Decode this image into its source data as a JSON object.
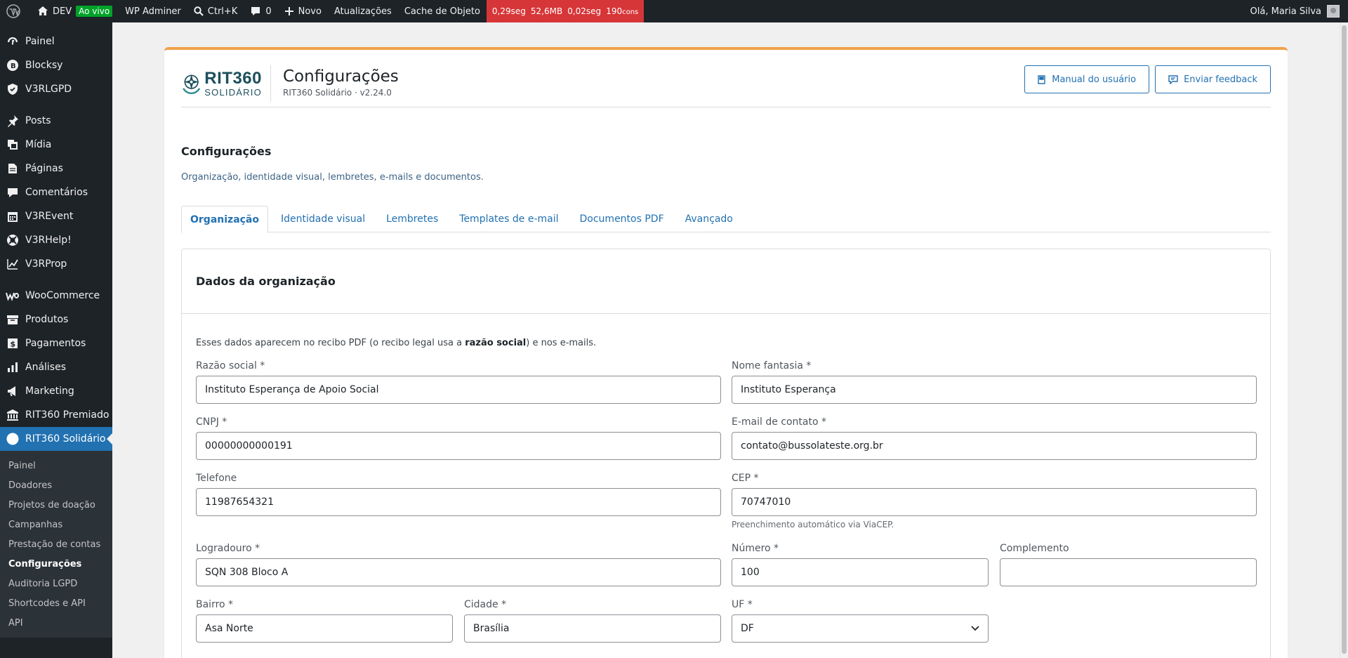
{
  "adminbar": {
    "site_name": "DEV",
    "live_badge": "Ao vivo",
    "adminer": "WP Adminer",
    "search_shortcut": "Ctrl+K",
    "comments_count": "0",
    "new_label": "Novo",
    "updates_label": "Atualizações",
    "cache_label": "Cache de Objeto",
    "perf": {
      "time": "0,29seg",
      "memory": "52,6MB",
      "query_time": "0,02seg",
      "queries": "190",
      "queries_unit": "cons"
    },
    "greeting": "Olá, Maria Silva"
  },
  "sidebar": {
    "items": [
      {
        "label": "Painel",
        "icon": "dashboard-icon"
      },
      {
        "label": "Blocksy",
        "icon": "blocksy-icon"
      },
      {
        "label": "V3RLGPD",
        "icon": "shield-icon"
      },
      {
        "label": "Posts",
        "icon": "pin-icon"
      },
      {
        "label": "Mídia",
        "icon": "media-icon"
      },
      {
        "label": "Páginas",
        "icon": "page-icon"
      },
      {
        "label": "Comentários",
        "icon": "comment-icon"
      },
      {
        "label": "V3REvent",
        "icon": "calendar-icon"
      },
      {
        "label": "V3RHelp!",
        "icon": "lifebuoy-icon"
      },
      {
        "label": "V3RProp",
        "icon": "chart-line-icon"
      },
      {
        "label": "WooCommerce",
        "icon": "woo-icon"
      },
      {
        "label": "Produtos",
        "icon": "archive-icon"
      },
      {
        "label": "Pagamentos",
        "icon": "payments-icon"
      },
      {
        "label": "Análises",
        "icon": "bar-chart-icon"
      },
      {
        "label": "Marketing",
        "icon": "megaphone-icon"
      },
      {
        "label": "RIT360 Premiado",
        "icon": "bank-icon"
      },
      {
        "label": "RIT360 Solidário",
        "icon": "circle-icon"
      }
    ],
    "submenu": [
      "Painel",
      "Doadores",
      "Projetos de doação",
      "Campanhas",
      "Prestação de contas",
      "Configurações",
      "Auditoria LGPD",
      "Shortcodes e API",
      "API"
    ]
  },
  "header": {
    "logo_big": "RIT360",
    "logo_small": "SOLIDÁRIO",
    "title": "Configurações",
    "subtitle": "RIT360 Solidário · v2.24.0",
    "manual_label": "Manual do usuário",
    "feedback_label": "Enviar feedback"
  },
  "page": {
    "title": "Configurações",
    "description": "Organização, identidade visual, lembretes, e-mails e documentos."
  },
  "tabs": [
    "Organização",
    "Identidade visual",
    "Lembretes",
    "Templates de e-mail",
    "Documentos PDF",
    "Avançado"
  ],
  "card": {
    "title": "Dados da organização",
    "note_before": "Esses dados aparecem no recibo PDF (o recibo legal usa a ",
    "note_bold": "razão social",
    "note_after": ") e nos e-mails."
  },
  "form": {
    "razao_social": {
      "label": "Razão social *",
      "value": "Instituto Esperança de Apoio Social"
    },
    "nome_fantasia": {
      "label": "Nome fantasia *",
      "value": "Instituto Esperança"
    },
    "cnpj": {
      "label": "CNPJ *",
      "value": "00000000000191"
    },
    "email": {
      "label": "E-mail de contato *",
      "value": "contato@bussolateste.org.br"
    },
    "telefone": {
      "label": "Telefone",
      "value": "11987654321"
    },
    "cep": {
      "label": "CEP *",
      "value": "70747010",
      "help": "Preenchimento automático via ViaCEP."
    },
    "logradouro": {
      "label": "Logradouro *",
      "value": "SQN 308 Bloco A"
    },
    "numero": {
      "label": "Número *",
      "value": "100"
    },
    "complemento": {
      "label": "Complemento",
      "value": ""
    },
    "bairro": {
      "label": "Bairro *",
      "value": "Asa Norte"
    },
    "cidade": {
      "label": "Cidade *",
      "value": "Brasília"
    },
    "uf": {
      "label": "UF *",
      "value": "DF"
    }
  }
}
